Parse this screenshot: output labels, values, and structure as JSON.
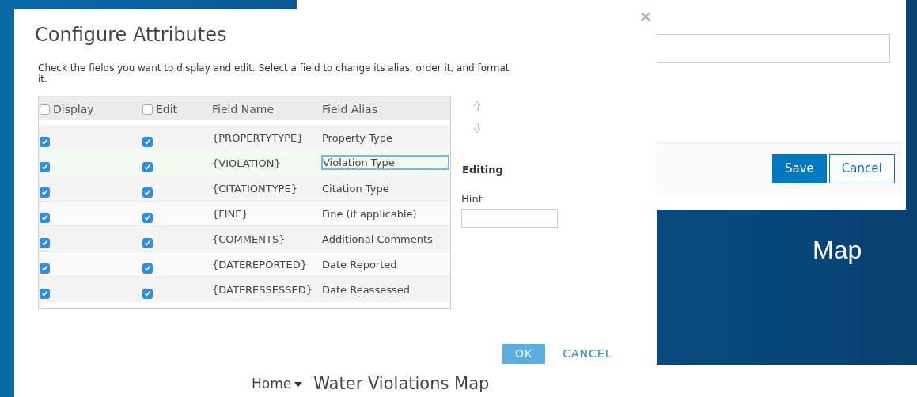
{
  "back_panel": {
    "buttons": [
      {
        "label": "Save",
        "kind": "primary"
      },
      {
        "label": "Cancel",
        "kind": "secondary"
      }
    ]
  },
  "map_label": "Map",
  "dialog": {
    "title": "Configure Attributes",
    "close": "×",
    "instructions": "Check the fields you want to display and edit. Select a field to change its alias, order it, and format it.",
    "columns": [
      {
        "label": "Display",
        "kind": "check",
        "checked": false
      },
      {
        "label": "Edit",
        "kind": "check",
        "checked": false
      },
      {
        "label": "Field Name",
        "kind": "text"
      },
      {
        "label": "Field Alias",
        "kind": "text"
      }
    ],
    "rows": [
      {
        "display": true,
        "edit": true,
        "field_name": "{PROPERTYTYPE}",
        "alias": "Property Type",
        "selected": false
      },
      {
        "display": true,
        "edit": true,
        "field_name": "{VIOLATION}",
        "alias": "Violation Type",
        "selected": true
      },
      {
        "display": true,
        "edit": true,
        "field_name": "{CITATIONTYPE}",
        "alias": "Citation Type",
        "selected": false
      },
      {
        "display": true,
        "edit": true,
        "field_name": "{FINE}",
        "alias": "Fine (if applicable)",
        "selected": false
      },
      {
        "display": true,
        "edit": true,
        "field_name": "{COMMENTS}",
        "alias": "Additional Comments",
        "selected": false
      },
      {
        "display": true,
        "edit": true,
        "field_name": "{DATEREPORTED}",
        "alias": "Date Reported",
        "selected": false
      },
      {
        "display": true,
        "edit": true,
        "field_name": "{DATERESSESSED}",
        "alias": "Date Reassessed",
        "selected": false
      }
    ],
    "editing_heading": "Editing",
    "hint_label": "Hint",
    "buttons": [
      {
        "label": "OK",
        "kind": "primary"
      },
      {
        "label": "CANCEL",
        "kind": "link"
      }
    ]
  },
  "breadcrumb": {
    "home": "Home",
    "title": "Water Violations Map"
  }
}
